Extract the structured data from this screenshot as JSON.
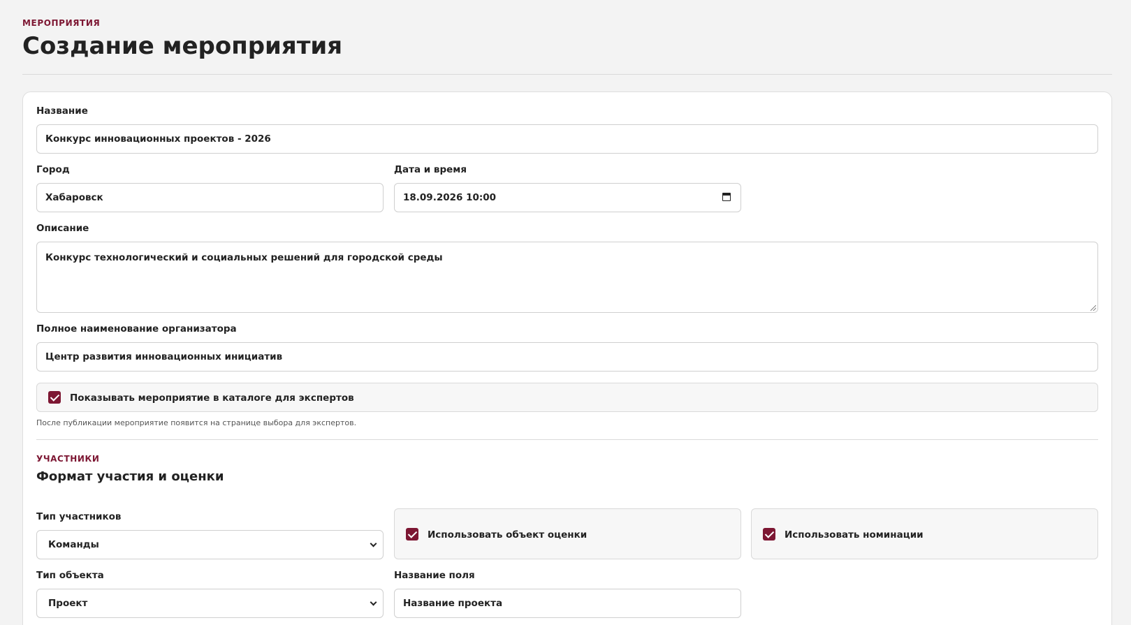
{
  "header": {
    "eyebrow": "МЕРОПРИЯТИЯ",
    "title": "Создание мероприятия"
  },
  "form": {
    "name": {
      "label": "Название",
      "value": "Конкурс инновационных проектов - 2026"
    },
    "city": {
      "label": "Город",
      "value": "Хабаровск"
    },
    "datetime": {
      "label": "Дата и время",
      "value": "18.09.2026 10:00"
    },
    "description": {
      "label": "Описание",
      "value": "Конкурс технологический и социальных решений для городской среды"
    },
    "organizer": {
      "label": "Полное наименование организатора",
      "value": "Центр развития инновационных инициатив"
    },
    "catalog": {
      "label": "Показывать мероприятие в каталоге для экспертов",
      "checked": true
    },
    "catalog_hint": "После публикации мероприятие появится на странице выбора для экспертов."
  },
  "participants": {
    "eyebrow": "УЧАСТНИКИ",
    "title": "Формат участия и оценки",
    "participant_type": {
      "label": "Тип участников",
      "value": "Команды"
    },
    "use_object": {
      "label": "Использовать объект оценки",
      "checked": true
    },
    "use_nominations": {
      "label": "Использовать номинации",
      "checked": true
    },
    "object_type": {
      "label": "Тип объекта",
      "value": "Проект"
    },
    "field_name": {
      "label": "Название поля",
      "value": "Название проекта"
    }
  },
  "colors": {
    "accent": "#7d1733",
    "background": "#f3f3f3",
    "card": "#ffffff"
  }
}
